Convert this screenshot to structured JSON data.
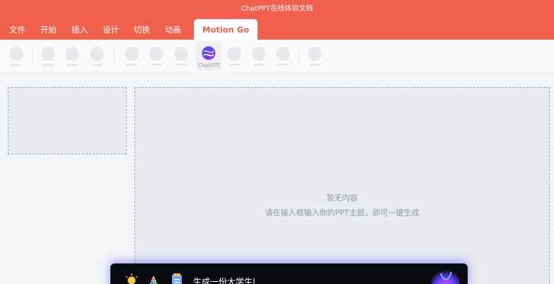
{
  "app": {
    "title": "ChatPPT在线体验文档"
  },
  "tabs": [
    {
      "label": "文件"
    },
    {
      "label": "开始"
    },
    {
      "label": "插入"
    },
    {
      "label": "设计"
    },
    {
      "label": "切换"
    },
    {
      "label": "动画"
    },
    {
      "label": "Motion Go",
      "active": true
    }
  ],
  "toolbar": {
    "chatppt_label": "ChatPPT"
  },
  "canvas": {
    "empty_title": "暂无内容",
    "empty_hint": "请在输入框输入你的PPT主题，即可一键生成"
  },
  "prompt_bar": {
    "text": "生成一份大学生|"
  },
  "colors": {
    "accent": "#f0604d",
    "bar_bg": "#0b0b12"
  }
}
